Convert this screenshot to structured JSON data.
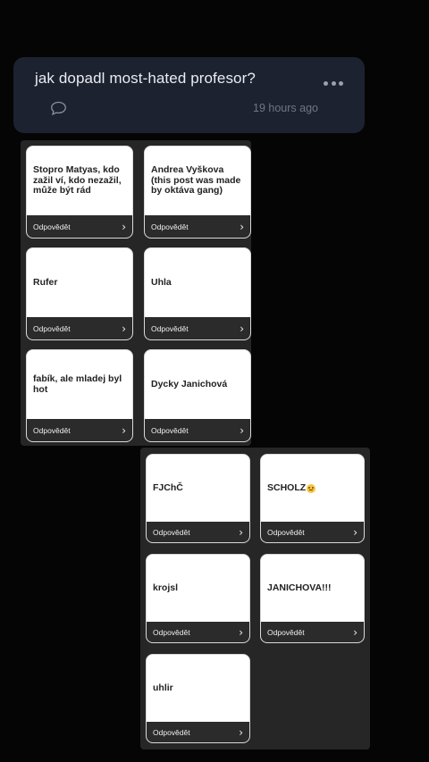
{
  "post": {
    "title": "jak dopadl most-hated profesor?",
    "time": "19 hours ago",
    "more_icon": "more-dots-icon",
    "comment_icon": "comment-bubble-icon"
  },
  "reply_label": "Odpovědět",
  "group_a": [
    {
      "text": "Stopro Matyas, kdo zažil ví, kdo nezažil, může být rád"
    },
    {
      "text": "Andrea Vyškova (this post was made by oktáva gang)"
    },
    {
      "text": "Rufer"
    },
    {
      "text": "Uhla"
    },
    {
      "text": "fabík, ale mladej byl hot"
    },
    {
      "text": "Dycky Janichová"
    }
  ],
  "group_b": [
    {
      "text": "FJChČ"
    },
    {
      "text": "SCHOLZ"
    },
    {
      "text": "krojsl"
    },
    {
      "text": "JANICHOVA!!!"
    },
    {
      "text": "uhlir"
    }
  ],
  "colors": {
    "background": "#050505",
    "header_bg": "#1d2230",
    "sheet_bg": "#262626",
    "card_bg": "#ffffff",
    "card_footer": "#2b2b2b"
  }
}
